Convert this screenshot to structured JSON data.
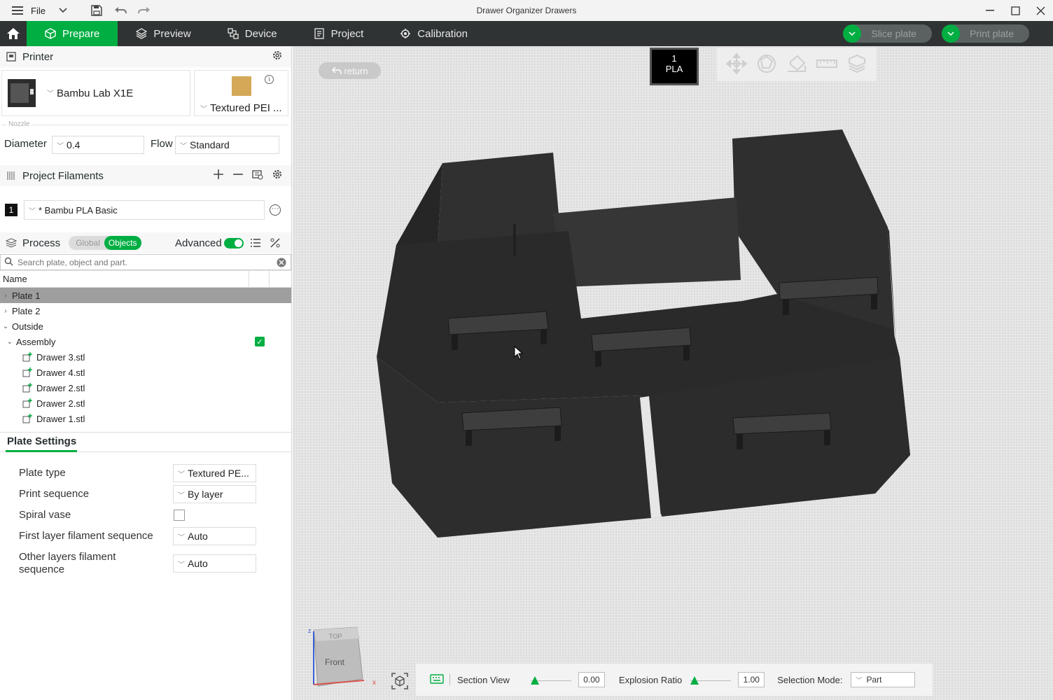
{
  "titlebar": {
    "file_label": "File",
    "title": "Drawer Organizer Drawers",
    "icons": [
      "hamburger-menu-icon",
      "chevron-down-icon",
      "save-icon",
      "undo-icon",
      "redo-icon",
      "minimize-icon",
      "maximize-icon",
      "close-icon"
    ]
  },
  "menubar": {
    "tabs": [
      {
        "label": "Prepare",
        "icon": "cube-icon",
        "active": true
      },
      {
        "label": "Preview",
        "icon": "layers-icon",
        "active": false
      },
      {
        "label": "Device",
        "icon": "device-icon",
        "active": false
      },
      {
        "label": "Project",
        "icon": "project-icon",
        "active": false
      },
      {
        "label": "Calibration",
        "icon": "calibration-icon",
        "active": false
      }
    ],
    "slice_label": "Slice plate",
    "print_label": "Print plate"
  },
  "printer": {
    "section_title": "Printer",
    "name": "Bambu Lab X1E",
    "plate": "Textured PEI ...",
    "nozzle_caption": "Nozzle",
    "diameter_label": "Diameter",
    "diameter_value": "0.4",
    "flow_label": "Flow",
    "flow_value": "Standard"
  },
  "filaments": {
    "section_title": "Project Filaments",
    "items": [
      {
        "index": "1",
        "name": "* Bambu PLA Basic"
      }
    ]
  },
  "process": {
    "section_title": "Process",
    "global_label": "Global",
    "objects_label": "Objects",
    "advanced_label": "Advanced",
    "advanced_on": true,
    "search_placeholder": "Search plate, object and part."
  },
  "tree": {
    "header_name": "Name",
    "rows": [
      {
        "label": "Plate 1",
        "level": 0,
        "arrow": "›",
        "selected": true
      },
      {
        "label": "Plate 2",
        "level": 0,
        "arrow": "›",
        "selected": false
      },
      {
        "label": "Outside",
        "level": 0,
        "arrow": "⌄",
        "selected": false
      },
      {
        "label": "Assembly",
        "level": 1,
        "arrow": "⌄",
        "selected": false,
        "checked": true
      },
      {
        "label": "Drawer 3.stl",
        "level": 2,
        "file": true
      },
      {
        "label": "Drawer 4.stl",
        "level": 2,
        "file": true
      },
      {
        "label": "Drawer 2.stl",
        "level": 2,
        "file": true
      },
      {
        "label": "Drawer 2.stl",
        "level": 2,
        "file": true
      },
      {
        "label": "Drawer 1.stl",
        "level": 2,
        "file": true
      }
    ]
  },
  "plate_settings": {
    "tab_label": "Plate Settings",
    "plate_type_label": "Plate type",
    "plate_type_value": "Textured PE...",
    "print_sequence_label": "Print sequence",
    "print_sequence_value": "By layer",
    "spiral_vase_label": "Spiral vase",
    "spiral_vase_checked": false,
    "first_layer_label": "First layer filament sequence",
    "first_layer_value": "Auto",
    "other_layers_label_1": "Other layers filament",
    "other_layers_label_2": "sequence",
    "other_layers_value": "Auto"
  },
  "viewport": {
    "return_label": "return",
    "filament_badge_index": "1",
    "filament_badge_type": "PLA",
    "toolbar_icons": [
      "move-icon",
      "rotate-icon",
      "paint-icon",
      "measure-icon",
      "assemble-icon"
    ],
    "navcube_face": "Front",
    "navcube_top": "TOP",
    "axis_x": "x",
    "axis_z": "z",
    "section_view_label": "Section View",
    "section_view_value": "0.00",
    "explosion_ratio_label": "Explosion Ratio",
    "explosion_ratio_value": "1.00",
    "selection_mode_label": "Selection Mode:",
    "selection_mode_value": "Part"
  },
  "colors": {
    "accent": "#00ae42",
    "menubar_bg": "#2f3333",
    "model": "#2a2a2a"
  }
}
